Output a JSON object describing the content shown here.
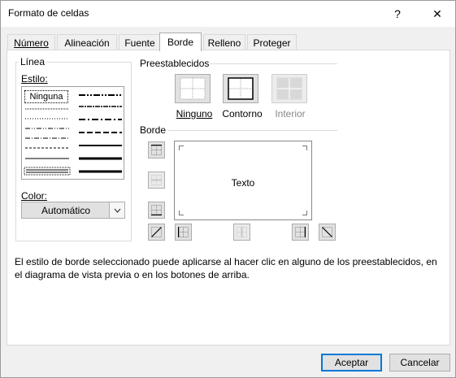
{
  "window": {
    "title": "Formato de celdas",
    "help_glyph": "?",
    "close_glyph": "✕"
  },
  "tabs": [
    "Número",
    "Alineación",
    "Fuente",
    "Borde",
    "Relleno",
    "Proteger"
  ],
  "active_tab": "Borde",
  "linea": {
    "group_title": "Línea",
    "estilo_label": "Estilo:",
    "style_none": "Ninguna",
    "color_label": "Color:",
    "color_value": "Automático"
  },
  "preestablecidos": {
    "title": "Preestablecidos",
    "buttons": [
      {
        "label": "Ninguno",
        "enabled": true
      },
      {
        "label": "Contorno",
        "enabled": true
      },
      {
        "label": "Interior",
        "enabled": false
      }
    ]
  },
  "borde": {
    "title": "Borde",
    "preview_text": "Texto",
    "buttons": [
      "border-top",
      "border-inside-horizontal",
      "border-bottom",
      "border-diagonal-up",
      "border-left",
      "border-inside-vertical",
      "border-right",
      "border-diagonal-down"
    ]
  },
  "description": "El estilo de borde seleccionado puede aplicarse al hacer clic en alguno de los preestablecidos, en el diagrama de vista previa o en los botones de arriba.",
  "footer": {
    "accept": "Aceptar",
    "cancel": "Cancelar"
  },
  "colors": {
    "accent": "#0078d7",
    "button_face": "#e1e1e1",
    "panel": "#ffffff",
    "dialog": "#f0f0f0"
  }
}
